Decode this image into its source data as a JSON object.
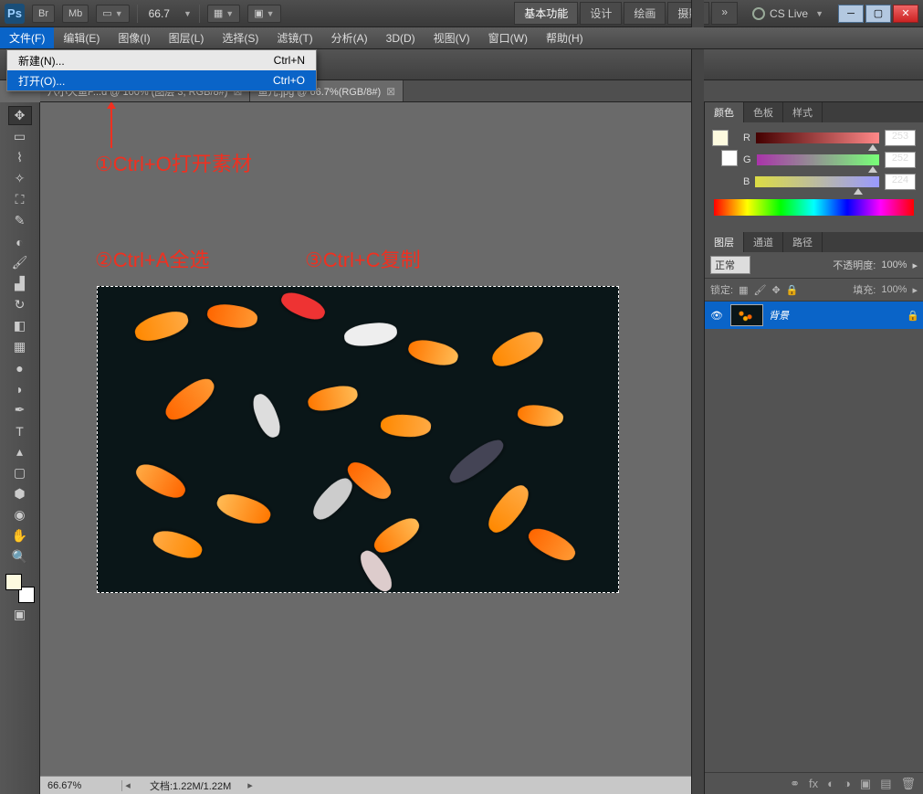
{
  "topbar": {
    "ps": "Ps",
    "br": "Br",
    "mb": "Mb",
    "zoom": "66.7"
  },
  "workspace": {
    "tabs": [
      "基本功能",
      "设计",
      "绘画",
      "摄影"
    ],
    "more": "»",
    "cslive": "CS Live"
  },
  "menu": [
    "文件(F)",
    "编辑(E)",
    "图像(I)",
    "图层(L)",
    "选择(S)",
    "滤镜(T)",
    "分析(A)",
    "3D(D)",
    "视图(V)",
    "窗口(W)",
    "帮助(H)"
  ],
  "dropdown": [
    {
      "label": "新建(N)...",
      "shortcut": "Ctrl+N"
    },
    {
      "label": "打开(O)...",
      "shortcut": "Ctrl+O"
    }
  ],
  "doctabs": [
    {
      "title": "八小天鱼P...d @ 100% (图层 3, RGB/8#)"
    },
    {
      "title": "鱼儿.jpg @ 66.7%(RGB/8#)"
    }
  ],
  "annotations": {
    "a1": "①Ctrl+O打开素材",
    "a2": "②Ctrl+A全选",
    "a3": "③Ctrl+C复制"
  },
  "statusbar": {
    "zoom": "66.67%",
    "info": "文档:1.22M/1.22M"
  },
  "colorpanel": {
    "tabs": [
      "颜色",
      "色板",
      "样式"
    ],
    "r": {
      "label": "R",
      "val": "253"
    },
    "g": {
      "label": "G",
      "val": "252"
    },
    "b": {
      "label": "B",
      "val": "224"
    }
  },
  "layerpanel": {
    "tabs": [
      "图层",
      "通道",
      "路径"
    ],
    "blend": "正常",
    "opacity_label": "不透明度:",
    "opacity": "100%",
    "lock_label": "锁定:",
    "fill_label": "填充:",
    "fill": "100%",
    "layer_name": "背景"
  }
}
